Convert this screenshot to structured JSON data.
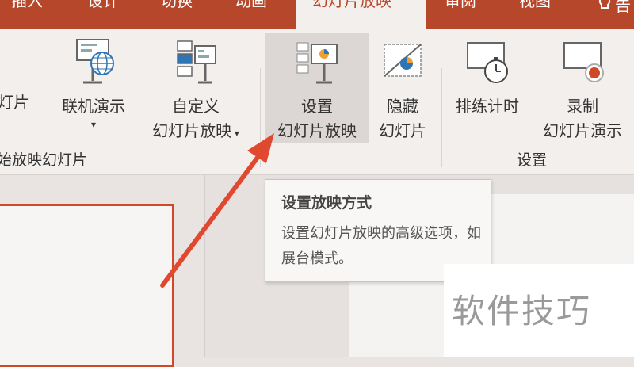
{
  "tabs": [
    {
      "label": "插入"
    },
    {
      "label": "设计"
    },
    {
      "label": "切换"
    },
    {
      "label": "动画"
    },
    {
      "label": "幻灯片放映",
      "active": true
    },
    {
      "label": "审阅"
    },
    {
      "label": "视图"
    },
    {
      "label": "告"
    }
  ],
  "ribbon": {
    "start_group": {
      "partial_button_label": "灯片",
      "online_label": "联机演示",
      "custom_line1": "自定义",
      "custom_line2": "幻灯片放映",
      "group_label": "始放映幻灯片"
    },
    "setup_group": {
      "setup_line1": "设置",
      "setup_line2": "幻灯片放映",
      "hide_line1": "隐藏",
      "hide_line2": "幻灯片",
      "rehearse_label": "排练计时",
      "record_line1": "录制",
      "record_line2": "幻灯片演示",
      "group_label": "设置"
    }
  },
  "tooltip": {
    "title": "设置放映方式",
    "description": "设置幻灯片放映的高级选项，如展台模式。"
  },
  "watermark": "软件技巧",
  "colors": {
    "accent": "#b7472a",
    "arrow": "#e0492f",
    "thumb_border": "#d24726"
  }
}
